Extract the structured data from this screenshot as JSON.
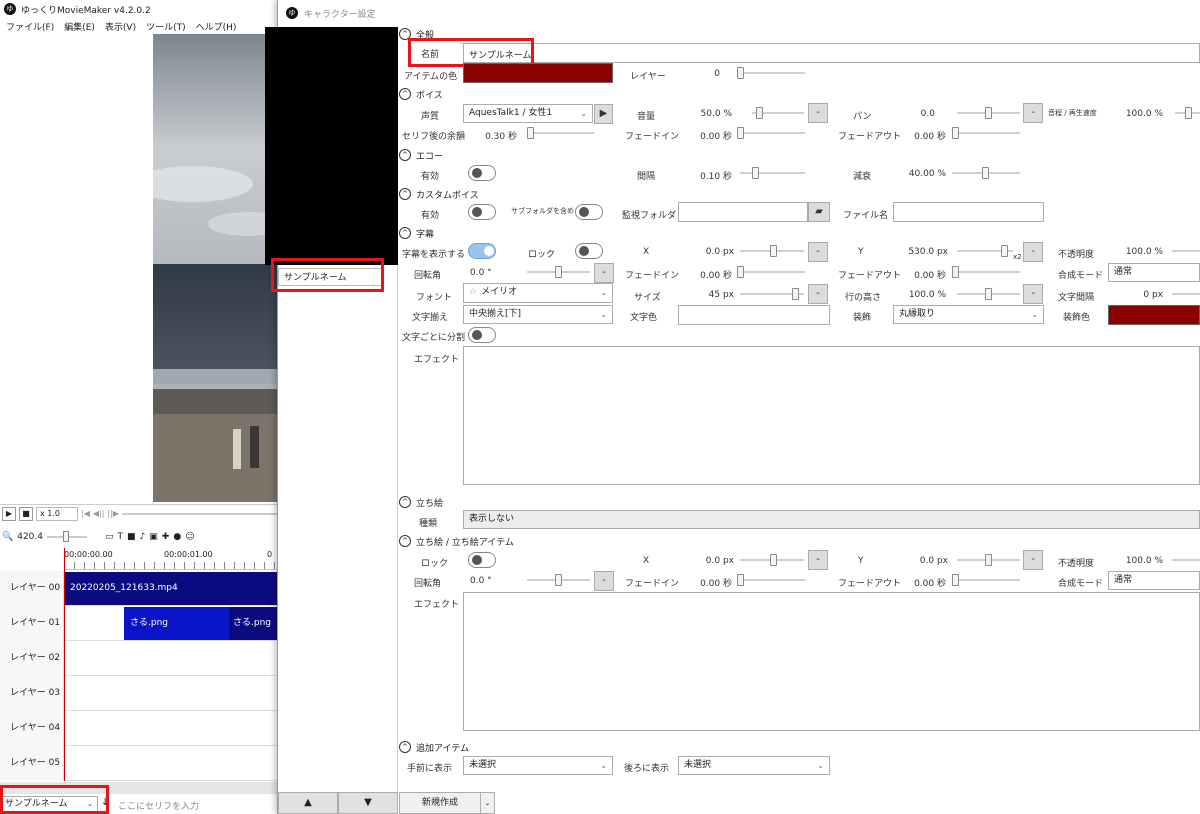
{
  "main_window": {
    "title": "ゆっくりMovieMaker v4.2.0.2",
    "menu": [
      "ファイル(F)",
      "編集(E)",
      "表示(V)",
      "ツール(T)",
      "ヘルプ(H)"
    ],
    "playback_speed": "x 1.0",
    "zoom": "420.4",
    "time_marks": [
      "00:00:00.00",
      "00:00:01.00",
      "0"
    ],
    "layers": [
      {
        "name": "レイヤー 00",
        "clips": [
          "20220205_121633.mp4"
        ]
      },
      {
        "name": "レイヤー 01",
        "clips": [
          "さる.png",
          "さる.png"
        ]
      },
      {
        "name": "レイヤー 02",
        "clips": []
      },
      {
        "name": "レイヤー 03",
        "clips": []
      },
      {
        "name": "レイヤー 04",
        "clips": []
      },
      {
        "name": "レイヤー 05",
        "clips": []
      }
    ],
    "character_select": "サンプルネーム",
    "dialogue_placeholder": "ここにセリフを入力"
  },
  "dialog": {
    "title": "キャラクター設定",
    "character_list": [
      "サンプルネーム"
    ],
    "up_label": "▲",
    "down_label": "▼",
    "new_button": "新規作成",
    "sections": {
      "general": {
        "title": "全般",
        "name_label": "名前",
        "name_value": "サンプルネーム",
        "item_color_label": "アイテムの色",
        "item_color": "#8b0000",
        "layer_label": "レイヤー",
        "layer_value": "0"
      },
      "voice": {
        "title": "ボイス",
        "voice_label": "声質",
        "voice_value": "AquesTalk1 / 女性1",
        "volume_label": "音量",
        "volume_value": "50.0 %",
        "pan_label": "パン",
        "pan_value": "0.0",
        "speed_label": "音程 / 再生速度",
        "speed_value": "100.0 %",
        "margin_label": "セリフ後の余韻",
        "margin_value": "0.30 秒",
        "fadein_label": "フェードイン",
        "fadein_value": "0.00 秒",
        "fadeout_label": "フェードアウト",
        "fadeout_value": "0.00 秒"
      },
      "echo": {
        "title": "エコー",
        "enabled_label": "有効",
        "interval_label": "間隔",
        "interval_value": "0.10 秒",
        "decay_label": "減衰",
        "decay_value": "40.00 %"
      },
      "custom_voice": {
        "title": "カスタムボイス",
        "enabled_label": "有効",
        "subfolder_label": "サブフォルダを含める",
        "watch_folder_label": "監視フォルダ",
        "file_name_label": "ファイル名"
      },
      "subtitle": {
        "title": "字幕",
        "show_label": "字幕を表示する",
        "lock_label": "ロック",
        "x_label": "X",
        "x_value": "0.0 px",
        "y_label": "Y",
        "y_value": "530.0 px",
        "y_mult": "x2",
        "opacity_label": "不透明度",
        "opacity_value": "100.0 %",
        "rotation_label": "回転角",
        "rotation_value": "0.0 °",
        "fadein_label": "フェードイン",
        "fadein_value": "0.00 秒",
        "fadeout_label": "フェードアウト",
        "fadeout_value": "0.00 秒",
        "blend_label": "合成モード",
        "blend_value": "通常",
        "font_label": "フォント",
        "font_value": "メイリオ",
        "size_label": "サイズ",
        "size_value": "45 px",
        "line_height_label": "行の高さ",
        "line_height_value": "100.0 %",
        "char_spacing_label": "文字間隔",
        "char_spacing_value": "0 px",
        "align_label": "文字揃え",
        "align_value": "中央揃え[下]",
        "text_color_label": "文字色",
        "decoration_label": "装飾",
        "decoration_value": "丸縁取り",
        "decoration_color_label": "装飾色",
        "decoration_color": "#8b0000",
        "split_label": "文字ごとに分割",
        "effect_label": "エフェクト"
      },
      "portrait": {
        "title": "立ち絵",
        "type_label": "種類",
        "type_value": "表示しない"
      },
      "portrait_item": {
        "title": "立ち絵 / 立ち絵アイテム",
        "lock_label": "ロック",
        "x_label": "X",
        "x_value": "0.0 px",
        "y_label": "Y",
        "y_value": "0.0 px",
        "opacity_label": "不透明度",
        "opacity_value": "100.0 %",
        "rotation_label": "回転角",
        "rotation_value": "0.0 °",
        "fadein_label": "フェードイン",
        "fadein_value": "0.00 秒",
        "fadeout_label": "フェードアウト",
        "fadeout_value": "0.00 秒",
        "blend_label": "合成モード",
        "blend_value": "通常",
        "effect_label": "エフェクト"
      },
      "additional": {
        "title": "追加アイテム",
        "front_label": "手前に表示",
        "front_value": "未選択",
        "back_label": "後ろに表示",
        "back_value": "未選択"
      }
    }
  },
  "colors": {
    "accent_red": "#e8141b",
    "timeline_clip": "#0b0b80",
    "clip_highlight": "#0a14c8"
  }
}
